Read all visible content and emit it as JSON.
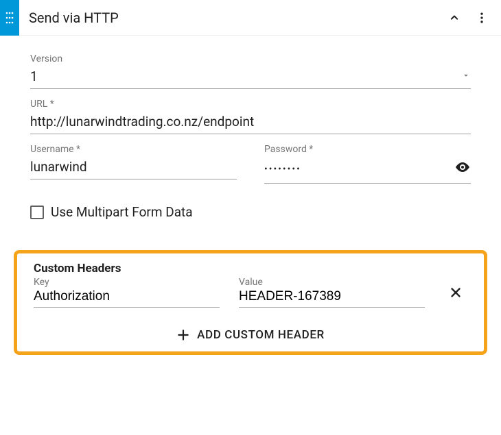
{
  "header": {
    "title": "Send via HTTP"
  },
  "fields": {
    "version": {
      "label": "Version",
      "value": "1"
    },
    "url": {
      "label": "URL *",
      "value": "http://lunarwindtrading.co.nz/endpoint"
    },
    "username": {
      "label": "Username *",
      "value": "lunarwind"
    },
    "password": {
      "label": "Password *",
      "mask": "••••••••"
    }
  },
  "multipart": {
    "label": "Use Multipart Form Data",
    "checked": false
  },
  "customHeaders": {
    "title": "Custom Headers",
    "keyLabel": "Key",
    "valueLabel": "Value",
    "rows": [
      {
        "key": "Authorization",
        "value": "HEADER-167389"
      }
    ],
    "addLabel": "ADD CUSTOM HEADER"
  }
}
